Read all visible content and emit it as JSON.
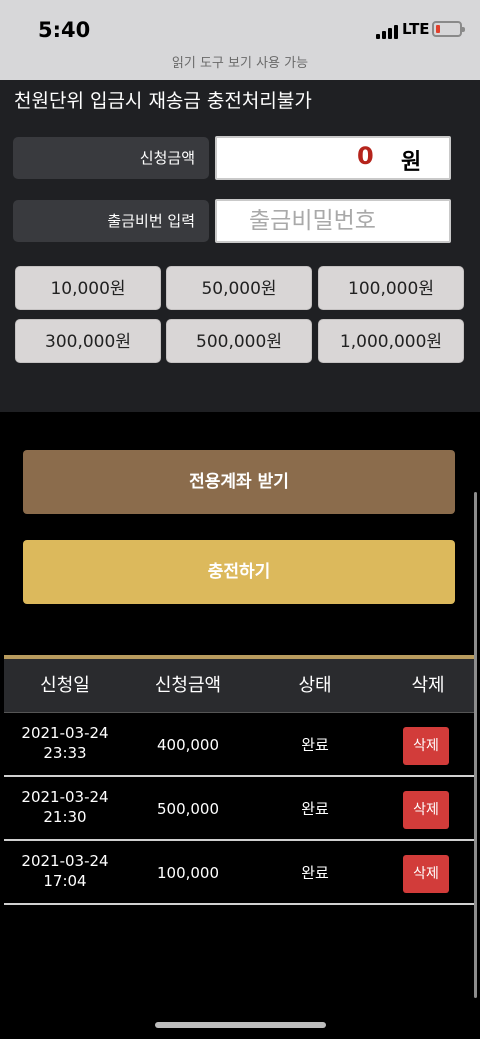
{
  "status_bar": {
    "time": "5:40",
    "network": "LTE",
    "reader_hint": "읽기 도구 보기 사용 가능"
  },
  "notice": "천원단위 입금시 재송금 충전처리불가",
  "form": {
    "amount_label": "신청금액",
    "amount_value": "0",
    "amount_unit": "원",
    "password_label": "출금비번 입력",
    "password_placeholder": "출금비밀번호"
  },
  "amount_buttons": [
    "10,000원",
    "50,000원",
    "100,000원",
    "300,000원",
    "500,000원",
    "1,000,000원"
  ],
  "actions": {
    "account_label": "전용계좌 받기",
    "charge_label": "충전하기"
  },
  "table": {
    "headers": [
      "신청일",
      "신청금액",
      "상태",
      "삭제"
    ],
    "rows": [
      {
        "date": "2021-03-24",
        "time": "23:33",
        "amount": "400,000",
        "status": "완료",
        "delete": "삭제"
      },
      {
        "date": "2021-03-24",
        "time": "21:30",
        "amount": "500,000",
        "status": "완료",
        "delete": "삭제"
      },
      {
        "date": "2021-03-24",
        "time": "17:04",
        "amount": "100,000",
        "status": "완료",
        "delete": "삭제"
      }
    ]
  },
  "colors": {
    "account_button": "#8b6c4c",
    "charge_button": "#dcb95c",
    "delete_button": "#d23c3a",
    "amount_value": "#b5241c"
  }
}
